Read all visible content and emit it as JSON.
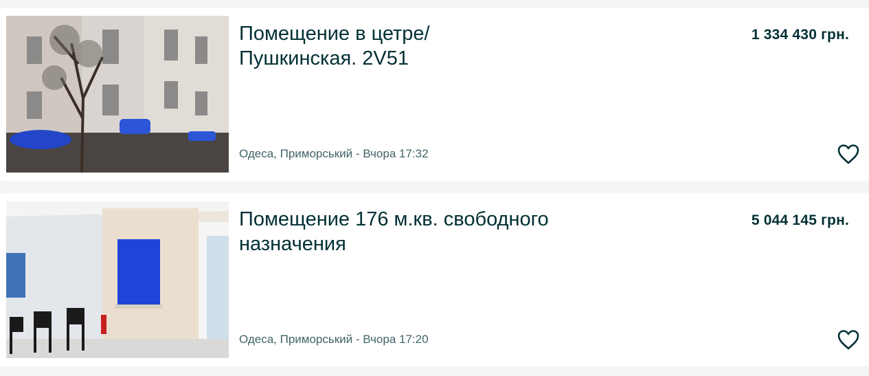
{
  "listings": [
    {
      "title_line1": "Помещение в цетре/",
      "title_line2": "Пушкинская. 2V51",
      "price": "1 334 430 грн.",
      "meta": "Одеса, Приморський - Вчора 17:32",
      "favorite_icon": "heart-outline-icon"
    },
    {
      "title_line1": "Помещение 176 м.кв. свободного",
      "title_line2": "назначения",
      "price": "5 044 145 грн.",
      "meta": "Одеса, Приморський - Вчора 17:20",
      "favorite_icon": "heart-outline-icon"
    }
  ],
  "colors": {
    "text_primary": "#002f34",
    "text_meta": "#406367",
    "page_background": "#f2f4f5",
    "card_background": "#ffffff"
  }
}
